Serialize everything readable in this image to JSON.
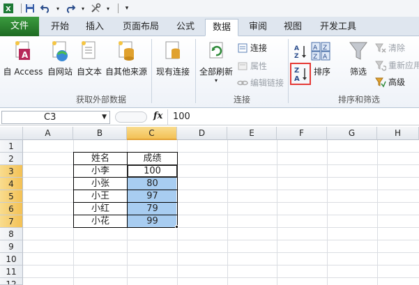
{
  "tabs": {
    "file": "文件",
    "items": [
      "开始",
      "插入",
      "页面布局",
      "公式",
      "数据",
      "审阅",
      "视图",
      "开发工具"
    ],
    "active": "数据"
  },
  "ribbon": {
    "get_external": {
      "buttons": [
        "自 Access",
        "自网站",
        "自文本",
        "自其他来源"
      ],
      "existing": "现有连接",
      "label": "获取外部数据"
    },
    "connections": {
      "refresh_all": "全部刷新",
      "connections": "连接",
      "properties": "属性",
      "edit_links": "编辑链接",
      "label": "连接"
    },
    "sort_filter": {
      "sort": "排序",
      "filter": "筛选",
      "clear": "清除",
      "reapply": "重新应用",
      "advanced": "高级",
      "label": "排序和筛选",
      "highlight_color": "#e53935"
    }
  },
  "formula_bar": {
    "cell_ref": "C3",
    "fx": "fx",
    "value": "100"
  },
  "sheet": {
    "columns": [
      "A",
      "B",
      "C",
      "D",
      "E",
      "F",
      "G",
      "H"
    ],
    "selected_column": "C",
    "rows": [
      "1",
      "2",
      "3",
      "4",
      "5",
      "6",
      "7",
      "8",
      "9",
      "10",
      "11",
      "12"
    ],
    "selected_rows": [
      "3",
      "4",
      "5",
      "6",
      "7"
    ],
    "header": {
      "name": "姓名",
      "score": "成绩"
    },
    "data": [
      {
        "name": "小李",
        "score": "100"
      },
      {
        "name": "小张",
        "score": "80"
      },
      {
        "name": "小王",
        "score": "97"
      },
      {
        "name": "小红",
        "score": "79"
      },
      {
        "name": "小花",
        "score": "99"
      }
    ],
    "selection_color": "#a8cdf1"
  }
}
